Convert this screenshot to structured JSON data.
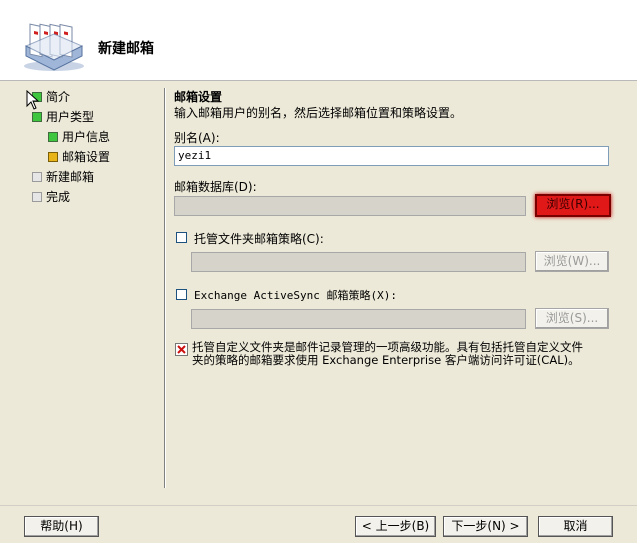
{
  "header": {
    "title": "新建邮箱"
  },
  "nav": {
    "items": [
      {
        "label": "简介",
        "state": "done"
      },
      {
        "label": "用户类型",
        "state": "done"
      },
      {
        "label": "用户信息",
        "state": "done"
      },
      {
        "label": "邮箱设置",
        "state": "current"
      },
      {
        "label": "新建邮箱",
        "state": "pending"
      },
      {
        "label": "完成",
        "state": "pending"
      }
    ]
  },
  "main": {
    "section_title": "邮箱设置",
    "description": "输入邮箱用户的别名，然后选择邮箱位置和策略设置。",
    "alias_label": "别名(A):",
    "alias_value": "yezi1",
    "db_label": "邮箱数据库(D):",
    "db_value": "",
    "db_browse": "浏览(R)...",
    "managed_folder_label": "托管文件夹邮箱策略(C):",
    "managed_folder_checked": false,
    "managed_folder_value": "",
    "managed_folder_browse": "浏览(W)...",
    "activesync_label": "Exchange ActiveSync 邮箱策略(X):",
    "activesync_checked": false,
    "activesync_value": "",
    "activesync_browse": "浏览(S)...",
    "info_text_line1": "托管自定义文件夹是邮件记录管理的一项高级功能。具有包括托管自定义文件",
    "info_text_line2": "夹的策略的邮箱要求使用 Exchange Enterprise 客户端访问许可证(CAL)。"
  },
  "footer": {
    "help": "帮助(H)",
    "back": "< 上一步(B)",
    "next": "下一步(N) >",
    "cancel": "取消"
  },
  "colors": {
    "accent_red": "#e01818",
    "done_green": "#3ec63e",
    "current_yellow": "#e8b418"
  }
}
